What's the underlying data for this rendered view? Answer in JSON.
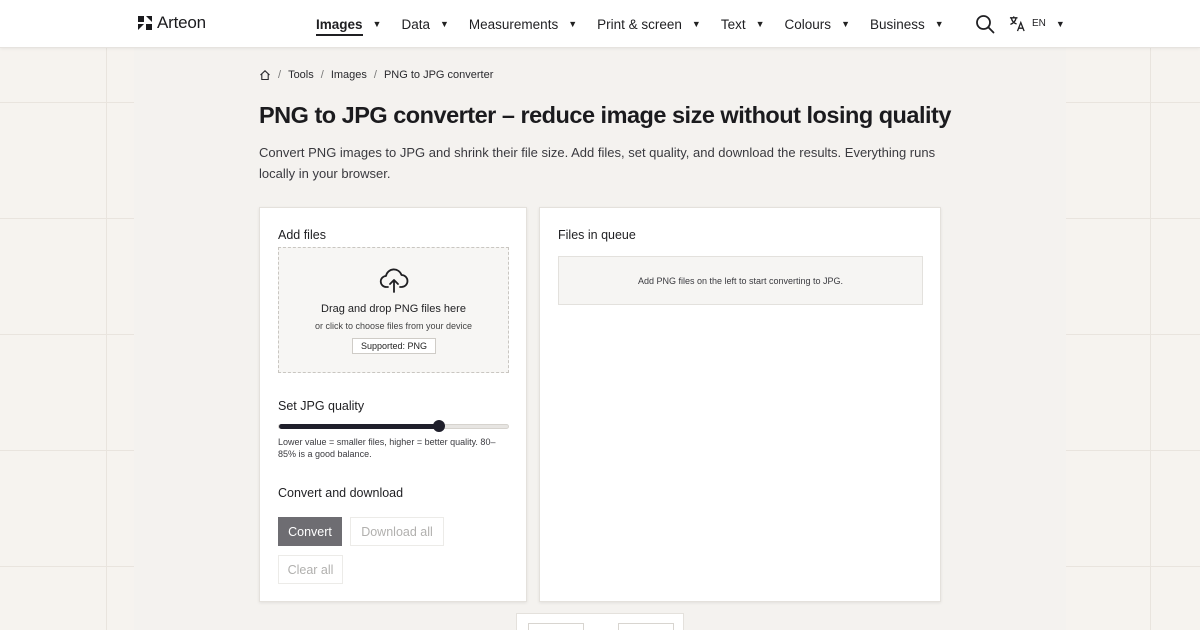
{
  "brand": {
    "name": "Arteon"
  },
  "nav": {
    "items": [
      {
        "label": "Images",
        "active": true
      },
      {
        "label": "Data"
      },
      {
        "label": "Measurements"
      },
      {
        "label": "Print & screen"
      },
      {
        "label": "Text"
      },
      {
        "label": "Colours"
      },
      {
        "label": "Business"
      }
    ],
    "caret": "▼"
  },
  "header": {
    "search_icon": "search-icon",
    "language_icon": "translate-icon",
    "language": "EN"
  },
  "breadcrumb": {
    "home_icon": "home-icon",
    "separator": "/",
    "items": [
      "Tools",
      "Images",
      "PNG to JPG converter"
    ]
  },
  "page": {
    "title": "PNG to JPG converter – reduce image size without losing quality",
    "intro": "Convert PNG images to JPG and shrink their file size. Add files, set quality, and download the results. Everything runs locally in your browser."
  },
  "add_files": {
    "title": "Add files",
    "dropzone_icon": "cloud-upload-icon",
    "dropzone_title": "Drag and drop PNG files here",
    "dropzone_subtitle": "or click to choose files from your device",
    "supported_badge": "Supported: PNG"
  },
  "quality": {
    "title": "Set JPG quality",
    "value_fraction": 0.7,
    "help": "Lower value = smaller files, higher = better quality. 80–85% is a good balance."
  },
  "actions": {
    "title": "Convert and download",
    "convert_label": "Convert",
    "download_all_label": "Download all",
    "clear_all_label": "Clear all"
  },
  "queue": {
    "title": "Files in queue",
    "empty_message": "Add PNG files on the left to start converting to JPG."
  },
  "colors": {
    "accent": "#1f1f2b",
    "primary_button": "#6e6d72",
    "disabled_text": "#b1b0ae"
  }
}
